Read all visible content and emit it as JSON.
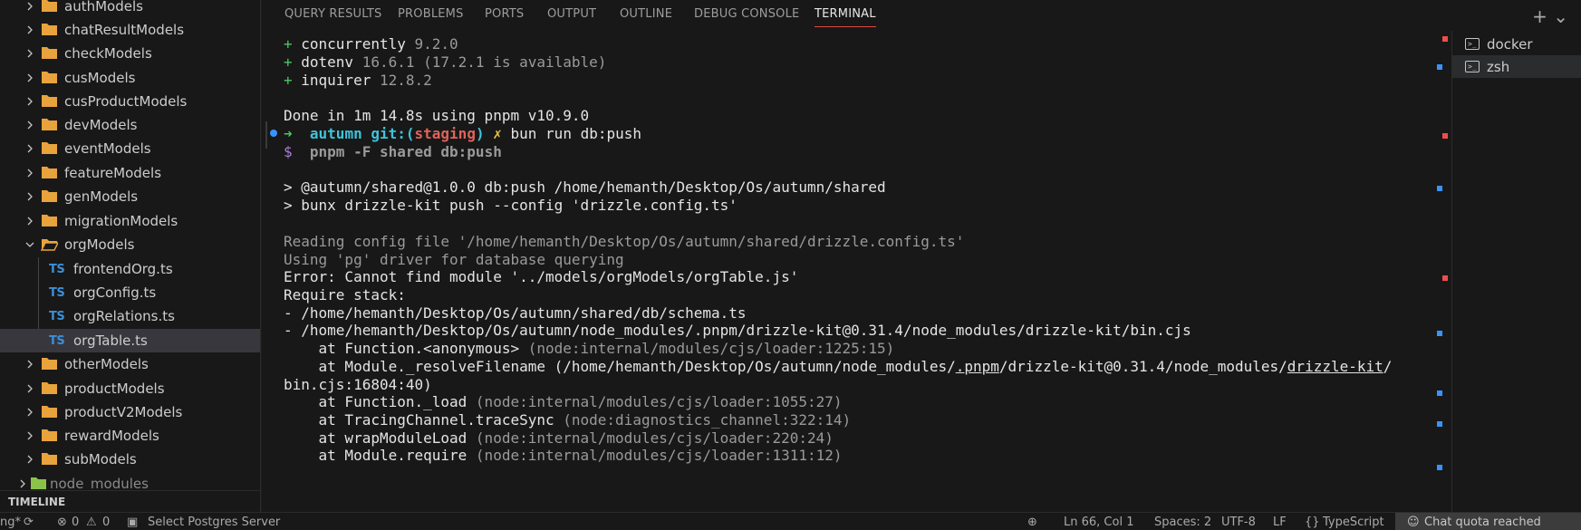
{
  "explorer": {
    "items": [
      {
        "label": "authModels",
        "kind": "folder",
        "expanded": false
      },
      {
        "label": "chatResultModels",
        "kind": "folder",
        "expanded": false
      },
      {
        "label": "checkModels",
        "kind": "folder",
        "expanded": false
      },
      {
        "label": "cusModels",
        "kind": "folder",
        "expanded": false
      },
      {
        "label": "cusProductModels",
        "kind": "folder",
        "expanded": false
      },
      {
        "label": "devModels",
        "kind": "folder",
        "expanded": false
      },
      {
        "label": "eventModels",
        "kind": "folder",
        "expanded": false
      },
      {
        "label": "featureModels",
        "kind": "folder",
        "expanded": false
      },
      {
        "label": "genModels",
        "kind": "folder",
        "expanded": false
      },
      {
        "label": "migrationModels",
        "kind": "folder",
        "expanded": false
      },
      {
        "label": "orgModels",
        "kind": "folder",
        "expanded": true
      },
      {
        "label": "frontendOrg.ts",
        "kind": "ts-file",
        "badge": "TS"
      },
      {
        "label": "orgConfig.ts",
        "kind": "ts-file",
        "badge": "TS"
      },
      {
        "label": "orgRelations.ts",
        "kind": "ts-file",
        "badge": "TS"
      },
      {
        "label": "orgTable.ts",
        "kind": "ts-file",
        "badge": "TS",
        "selected": true
      },
      {
        "label": "otherModels",
        "kind": "folder",
        "expanded": false
      },
      {
        "label": "productModels",
        "kind": "folder",
        "expanded": false
      },
      {
        "label": "productV2Models",
        "kind": "folder",
        "expanded": false
      },
      {
        "label": "rewardModels",
        "kind": "folder",
        "expanded": false
      },
      {
        "label": "subModels",
        "kind": "folder",
        "expanded": false
      },
      {
        "label": "node_modules",
        "kind": "node-folder",
        "expanded": false
      }
    ],
    "timeline_label": "TIMELINE"
  },
  "panel": {
    "tabs": [
      "QUERY RESULTS",
      "PROBLEMS",
      "PORTS",
      "OUTPUT",
      "OUTLINE",
      "DEBUG CONSOLE",
      "TERMINAL"
    ],
    "active_tab": "TERMINAL",
    "actions": "+ ⌄"
  },
  "terminal": {
    "lines": {
      "l1_plus": "+ ",
      "l1_pkg": "concurrently",
      "l1_ver": " 9.2.0",
      "l2_plus": "+ ",
      "l2_pkg": "dotenv",
      "l2_ver": " 16.6.1 (17.2.1 is available)",
      "l3_plus": "+ ",
      "l3_pkg": "inquirer",
      "l3_ver": " 12.8.2",
      "l5": "Done in 1m 14.8s using pnpm v10.9.0",
      "l6_arrow": "➜",
      "l6_dir": "autumn",
      "l6_git": "git:(",
      "l6_branch": "staging",
      "l6_close": ")",
      "l6_x": "✗",
      "l6_cmd": "bun run db:push",
      "l7_prompt": "$",
      "l7_cmd": "pnpm -F shared db:push",
      "l9": "> @autumn/shared@1.0.0 db:push /home/hemanth/Desktop/Os/autumn/shared",
      "l10": "> bunx drizzle-kit push --config 'drizzle.config.ts'",
      "l12": "Reading config file '/home/hemanth/Desktop/Os/autumn/shared/drizzle.config.ts'",
      "l13": "Using 'pg' driver for database querying",
      "l14": "Error: Cannot find module '../models/orgModels/orgTable.js'",
      "l15": "Require stack:",
      "l16": "- /home/hemanth/Desktop/Os/autumn/shared/db/schema.ts",
      "l17": "- /home/hemanth/Desktop/Os/autumn/node_modules/.pnpm/drizzle-kit@0.31.4/node_modules/drizzle-kit/bin.cjs",
      "l18_a": "    at Function.<anonymous> ",
      "l18_b": "(node:internal/modules/cjs/loader:1225:15)",
      "l19_a": "    at Module._resolveFilename (/home/hemanth/Desktop/Os/autumn/node_modules/",
      "l19_b": ".pnpm",
      "l19_c": "/drizzle-kit@0.31.4/node_modules/",
      "l19_d": "drizzle-kit",
      "l19_e": "/",
      "l20": "bin.cjs:16804:40)",
      "l21_a": "    at Function._load ",
      "l21_b": "(node:internal/modules/cjs/loader:1055:27)",
      "l22_a": "    at TracingChannel.traceSync ",
      "l22_b": "(node:diagnostics_channel:322:14)",
      "l23_a": "    at wrapModuleLoad ",
      "l23_b": "(node:internal/modules/cjs/loader:220:24)",
      "l24_a": "    at Module.require ",
      "l24_b": "(node:internal/modules/cjs/loader:1311:12)"
    }
  },
  "terminal_list": [
    {
      "name": "docker",
      "icon": "terminal-icon"
    },
    {
      "name": "zsh",
      "icon": "terminal-icon",
      "active": true
    }
  ],
  "statusbar": {
    "branch_fragment": "ng*",
    "errors": "0",
    "warnings": "0",
    "postgres": "Select Postgres Server",
    "position": "Ln 66, Col 1",
    "spaces": "Spaces: 2",
    "encoding": "UTF-8",
    "eol": "LF",
    "language": "TypeScript",
    "chat": "Chat quota reached"
  },
  "colors": {
    "accent_tab_underline": "#e24a3d",
    "ts_badge": "#3c8fd6",
    "folder": "#e8a33d",
    "ruler_blue": "#3794ff",
    "ruler_red": "#f14c4c"
  }
}
